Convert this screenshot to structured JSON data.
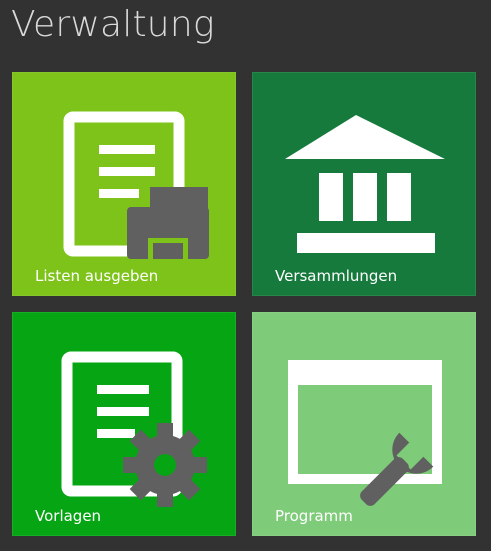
{
  "header": {
    "title": "Verwaltung"
  },
  "tiles": [
    {
      "label": "Listen ausgeben",
      "icon": "document-printer-icon",
      "color": "#7dc31a"
    },
    {
      "label": "Versammlungen",
      "icon": "building-columns-icon",
      "color": "#157a3c"
    },
    {
      "label": "Vorlagen",
      "icon": "document-gear-icon",
      "color": "#06a513"
    },
    {
      "label": "Programm",
      "icon": "window-wrench-icon",
      "color": "#7ecb79"
    }
  ]
}
